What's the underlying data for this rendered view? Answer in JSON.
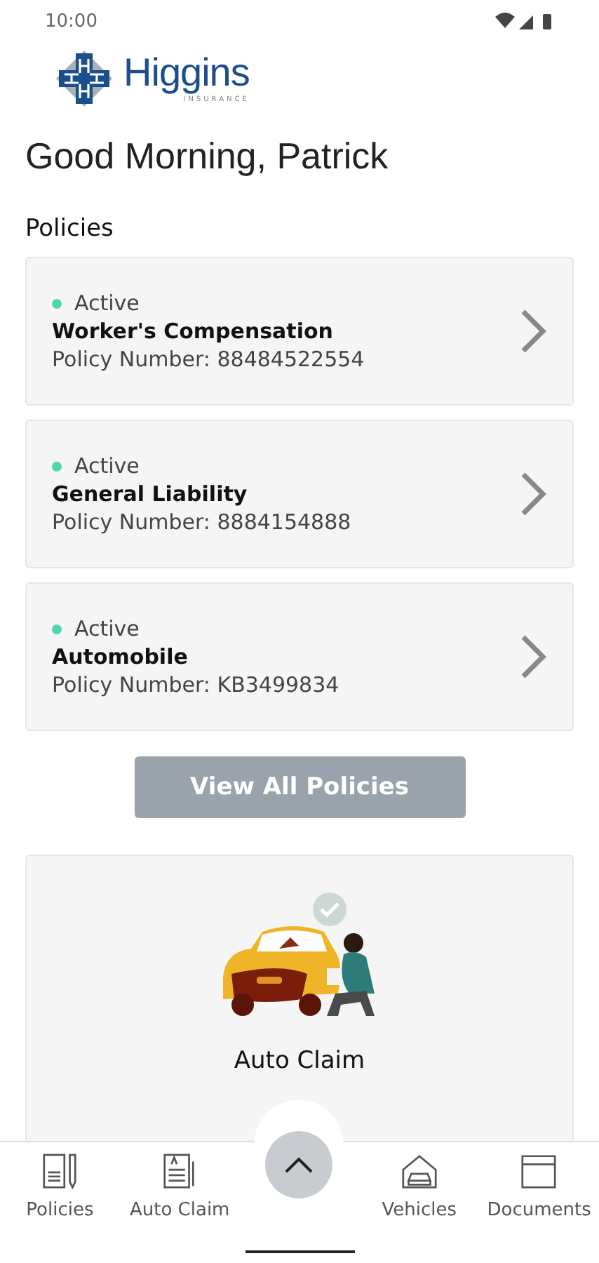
{
  "status_bar": {
    "time": "10:00"
  },
  "logo": {
    "name": "Higgins",
    "tagline": "INSURANCE"
  },
  "greeting": "Good Morning, Patrick",
  "policies_section": {
    "title": "Policies",
    "policies": [
      {
        "status": "Active",
        "color": "#4fd6b0",
        "name": "Worker's Compensation",
        "number": "Policy Number: 88484522554"
      },
      {
        "status": "Active",
        "color": "#4fd6b0",
        "name": "General Liability",
        "number": "Policy Number: 8884154888"
      },
      {
        "status": "Active",
        "color": "#4fd6b0",
        "name": "Automobile",
        "number": "Policy Number: KB3499834"
      }
    ],
    "view_all": "View All Policies"
  },
  "claim_card": {
    "title": "Auto Claim"
  },
  "bottom_nav": {
    "items": [
      {
        "label": "Policies",
        "kind": "policies"
      },
      {
        "label": "Auto Claim",
        "kind": "claim"
      },
      {
        "kind": "fab"
      },
      {
        "label": "Vehicles",
        "kind": "vehicles"
      },
      {
        "label": "Documents",
        "kind": "documents"
      }
    ]
  }
}
